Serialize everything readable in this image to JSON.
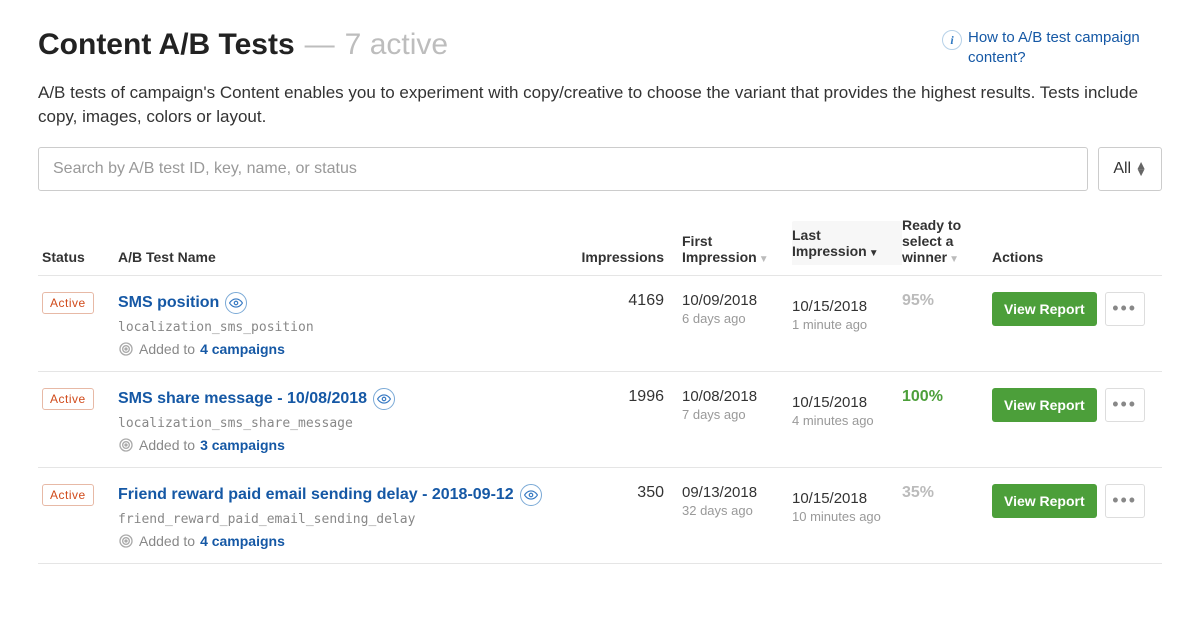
{
  "header": {
    "title": "Content A/B Tests",
    "dash": "—",
    "active_count": "7 active",
    "help_link": "How to A/B test campaign content?"
  },
  "description": "A/B tests of campaign's Content enables you to experiment with copy/creative to choose the variant that provides the highest results. Tests include copy, images, colors or layout.",
  "search": {
    "placeholder": "Search by A/B test ID, key, name, or status",
    "filter_label": "All"
  },
  "columns": {
    "status": "Status",
    "name": "A/B Test Name",
    "impressions": "Impressions",
    "first": "First Impression",
    "last": "Last Impression",
    "ready": "Ready to select a winner",
    "actions": "Actions"
  },
  "rows": [
    {
      "status": "Active",
      "name": "SMS position",
      "key": "localization_sms_position",
      "added_label": "Added to",
      "added_link": "4 campaigns",
      "impressions": "4169",
      "first_date": "10/09/2018",
      "first_rel": "6 days ago",
      "last_date": "10/15/2018",
      "last_rel": "1 minute ago",
      "ready_pct": "95%",
      "ready_class": "gray",
      "view_report": "View Report"
    },
    {
      "status": "Active",
      "name": "SMS share message - 10/08/2018",
      "key": "localization_sms_share_message",
      "added_label": "Added to",
      "added_link": "3 campaigns",
      "impressions": "1996",
      "first_date": "10/08/2018",
      "first_rel": "7 days ago",
      "last_date": "10/15/2018",
      "last_rel": "4 minutes ago",
      "ready_pct": "100%",
      "ready_class": "green",
      "view_report": "View Report"
    },
    {
      "status": "Active",
      "name": "Friend reward paid email sending delay - 2018-09-12",
      "key": "friend_reward_paid_email_sending_delay",
      "added_label": "Added to",
      "added_link": "4 campaigns",
      "impressions": "350",
      "first_date": "09/13/2018",
      "first_rel": "32 days ago",
      "last_date": "10/15/2018",
      "last_rel": "10 minutes ago",
      "ready_pct": "35%",
      "ready_class": "gray",
      "view_report": "View Report"
    }
  ]
}
